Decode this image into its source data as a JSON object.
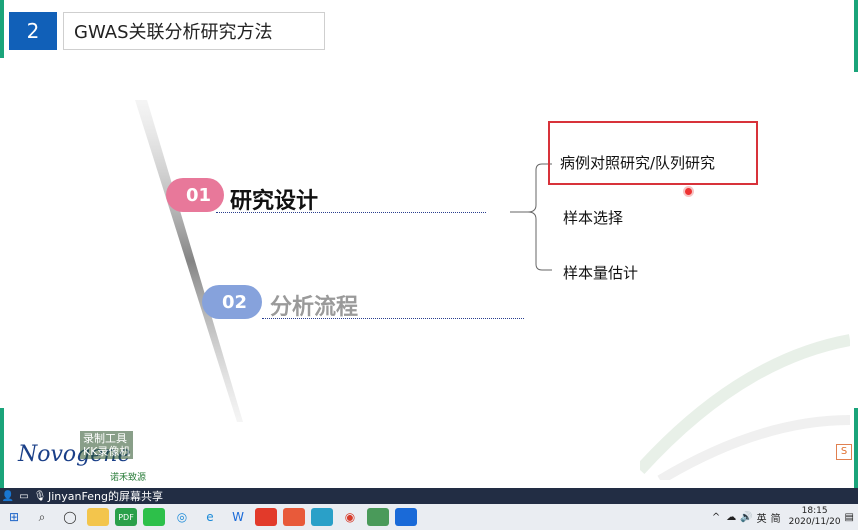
{
  "slide": {
    "number": "2",
    "title": "GWAS关联分析研究方法",
    "sections": [
      {
        "num": "01",
        "label": "研究设计"
      },
      {
        "num": "02",
        "label": "分析流程"
      }
    ],
    "items": [
      "病例对照研究/队列研究",
      "样本选择",
      "样本量估计"
    ],
    "logo": "Novogene",
    "logo_sub": "诺禾致源",
    "watermark_line1": "录制工具",
    "watermark_line2": "KK录像机"
  },
  "share_bar": {
    "text": "JinyanFeng的屏幕共享"
  },
  "taskbar": {
    "icons": [
      "windows-logo",
      "search",
      "task-view",
      "file-explorer",
      "pdf",
      "wechat",
      "qq-browser",
      "edge",
      "wps",
      "office",
      "powerpoint",
      "photos",
      "chrome",
      "file-manager",
      "meeting"
    ]
  },
  "tray": {
    "ime": "英",
    "ime2": "简",
    "time": "18:15",
    "date": "2020/11/20"
  },
  "colors": {
    "accent": "#1160b8",
    "pink": "#e8789a",
    "blue_pill": "#86a2dc",
    "highlight": "#d8323a"
  }
}
